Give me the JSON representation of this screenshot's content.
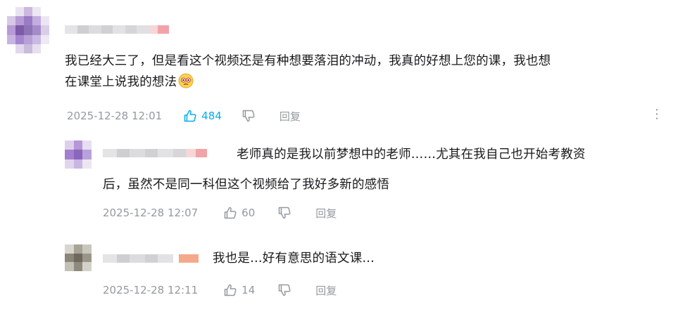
{
  "comment": {
    "text_line1": "我已经大三了，但是看这个视频还是有种想要落泪的冲动，我真的好想上您的课，我也想",
    "text_line2": "在课堂上说我的想法",
    "emoji": "sad-emoji",
    "time": "2025-12-28 12:01",
    "likes": "484",
    "reply_label": "回复",
    "more_icon": "⋮"
  },
  "replies": [
    {
      "text_line1": "老师真的是我以前梦想中的老师……尤其在我自己也开始考教资",
      "text_line2": "后，虽然不是同一科但这个视频给了我好多新的感悟",
      "time": "2025-12-28 12:07",
      "likes": "60",
      "reply_label": "回复"
    },
    {
      "text_line1": "我也是…好有意思的语文课…",
      "time": "2025-12-28 12:11",
      "likes": "14",
      "reply_label": "回复"
    }
  ],
  "colors": {
    "text": "#18191c",
    "meta": "#9499a0",
    "liked_accent": "#00aeec"
  }
}
